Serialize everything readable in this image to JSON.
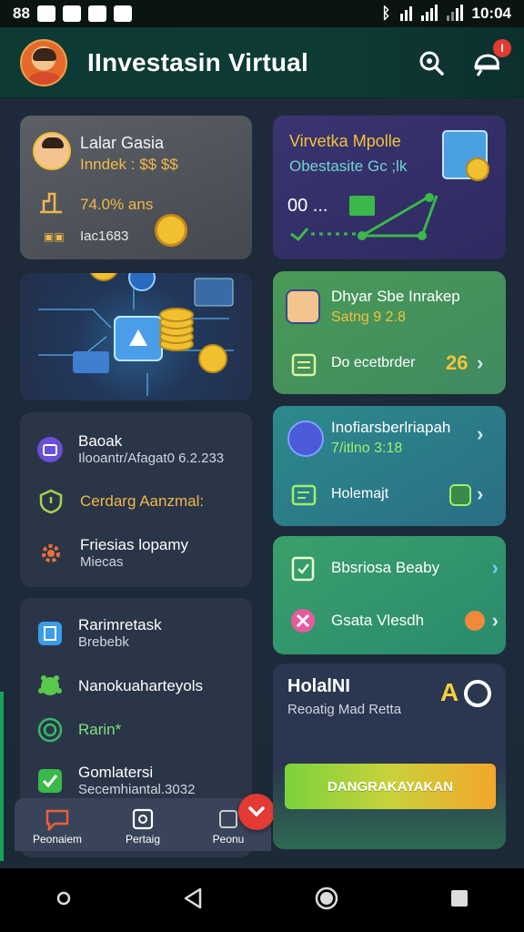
{
  "status_bar": {
    "left_text": "88",
    "time": "10:04"
  },
  "header": {
    "title": "IInvestasin Virtual",
    "notification_count": "I",
    "icons": [
      "search-icon",
      "notification-icon"
    ]
  },
  "left_column": {
    "profile_card": {
      "name": "Lalar Gasia",
      "tag": "Inndek : $$ $$",
      "stat": "74.0% ans",
      "code": "Iac1683"
    },
    "list_card_1": {
      "items": [
        {
          "title": "Baoak",
          "subtitle": "Ilooantr/Afagat0 6.2.233",
          "icon": "wallet-icon"
        },
        {
          "title": "Cerdarg Aanzmal:",
          "subtitle": "",
          "icon": "shield-icon"
        },
        {
          "title": "Friesias lopamy",
          "subtitle": "Miecas",
          "icon": "gear-icon"
        }
      ]
    },
    "list_card_2": {
      "items": [
        {
          "title": "Rarimretask",
          "subtitle": "Brebebk",
          "icon": "document-icon"
        },
        {
          "title": "Nanokuaharteyols",
          "subtitle": "",
          "icon": "robot-icon"
        },
        {
          "title": "Rarin*",
          "subtitle": "",
          "icon": "target-icon"
        },
        {
          "title": "Gomlatersi",
          "subtitle": "Secemhiantal.3032",
          "icon": "check-icon"
        }
      ]
    }
  },
  "bottom_nav": {
    "items": [
      {
        "label": "Peonaiem",
        "icon": "chat-icon"
      },
      {
        "label": "Pertaig",
        "icon": "portfolio-icon"
      },
      {
        "label": "Peonu",
        "icon": "menu-icon"
      }
    ]
  },
  "right_column": {
    "market_card": {
      "title": "Virvetka Mpolle",
      "subtitle": "Obestasite  Gc ;lk",
      "value_label": "00 ..."
    },
    "daily_card": {
      "title": "Dhyar Sbe Inrakep",
      "subtitle": "Satng 9 2.8",
      "action": "Do ecetbrder",
      "action_badge": "26"
    },
    "info_card": {
      "title": "Inofiarsberlriapah",
      "subtitle": "7/itlno 3:18",
      "action": "Holemajt"
    },
    "tasks_card": {
      "items": [
        {
          "label": "Bbsriosa Beaby",
          "icon": "clipboard-icon"
        },
        {
          "label": "Gsata Vlesdh",
          "icon": "cancel-icon"
        }
      ]
    },
    "promo_card": {
      "title": "HolalNI",
      "subtitle": "Reoatig Mad Retta",
      "badge": "A",
      "cta": "DANGRAKAYAKAN"
    }
  },
  "colors": {
    "header_bg": "#0d3a33",
    "accent_green": "#19a35a",
    "cta_start": "#7bd23c",
    "cta_end": "#f4a62a",
    "badge_red": "#e23b2f"
  }
}
